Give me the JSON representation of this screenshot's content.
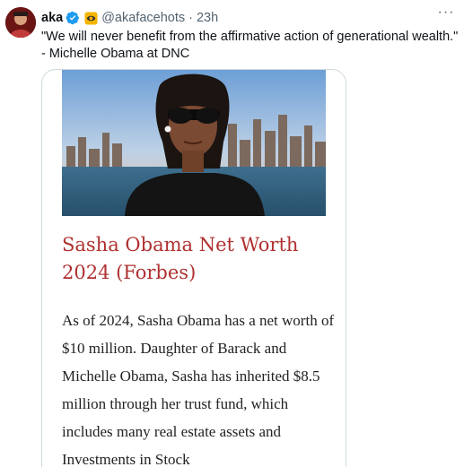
{
  "tweet": {
    "display_name": "aka",
    "handle": "@akafacehots",
    "separator": "·",
    "time": "23h",
    "more_label": "···",
    "text": "\"We will never benefit from the affirmative action of generational wealth.\" - Michelle Obama at DNC"
  },
  "article": {
    "title": "Sasha Obama Net Worth 2024 (Forbes)",
    "body": "As of 2024, Sasha Obama has a net worth of $10 million. Daughter of Barack and Michelle Obama, Sasha has inherited $8.5 million through her trust fund, which includes many real estate assets and Investments in Stock"
  },
  "icons": {
    "verified": "verified-badge-icon",
    "org": "gold-org-badge-icon",
    "more": "more-options-icon"
  },
  "colors": {
    "verified_blue": "#1d9bf0",
    "title_red": "#b03030",
    "muted": "#536471"
  }
}
